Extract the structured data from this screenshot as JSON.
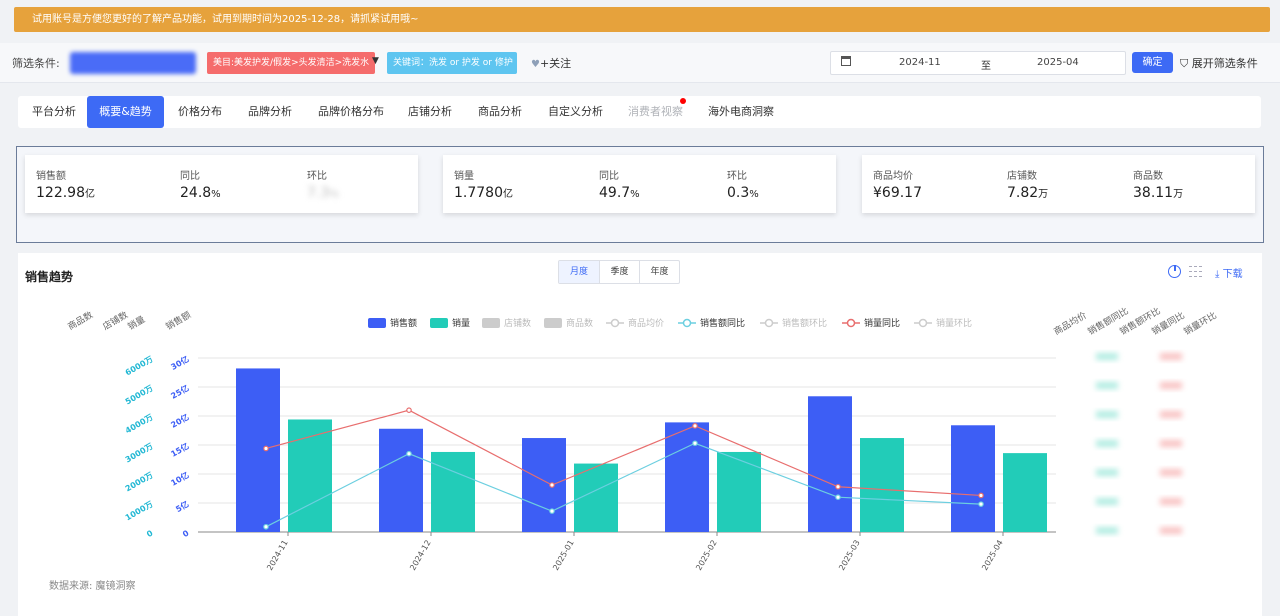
{
  "banner": {
    "text": "试用账号是方便您更好的了解产品功能，试用到期时间为2025-12-28，请抓紧试用哦~"
  },
  "filter": {
    "label": "筛选条件:",
    "category_tag": "美目:美发护发/假发>头发清洁>洗发水",
    "keyword_tag": "关键词：洗发 or 护发 or 修护",
    "follow": "+关注",
    "date_start": "2024-11",
    "date_to": "至",
    "date_end": "2025-04",
    "confirm": "确定",
    "expand": "展开筛选条件"
  },
  "tabs": [
    {
      "label": "平台分析",
      "state": "normal"
    },
    {
      "label": "概要&趋势",
      "state": "active"
    },
    {
      "label": "价格分布",
      "state": "normal"
    },
    {
      "label": "品牌分析",
      "state": "normal"
    },
    {
      "label": "品牌价格分布",
      "state": "normal"
    },
    {
      "label": "店铺分析",
      "state": "normal"
    },
    {
      "label": "商品分析",
      "state": "normal"
    },
    {
      "label": "自定义分析",
      "state": "normal"
    },
    {
      "label": "消费者视察",
      "state": "disabled"
    },
    {
      "label": "海外电商洞察",
      "state": "normal"
    }
  ],
  "kpi_groups": [
    {
      "items": [
        {
          "label": "销售额",
          "value": "122.98",
          "unit": "亿"
        },
        {
          "label": "同比",
          "value": "24.8",
          "unit": "%"
        },
        {
          "label": "环比",
          "value": "7.3",
          "unit": "%",
          "blurred": true
        }
      ]
    },
    {
      "items": [
        {
          "label": "销量",
          "value": "1.7780",
          "unit": "亿"
        },
        {
          "label": "同比",
          "value": "49.7",
          "unit": "%"
        },
        {
          "label": "环比",
          "value": "0.3",
          "unit": "%"
        }
      ]
    },
    {
      "items": [
        {
          "label": "商品均价",
          "value": "¥69.17",
          "unit": ""
        },
        {
          "label": "店铺数",
          "value": "7.82",
          "unit": "万"
        },
        {
          "label": "商品数",
          "value": "38.11",
          "unit": "万"
        }
      ]
    }
  ],
  "trend": {
    "title": "销售趋势",
    "periods": [
      "月度",
      "季度",
      "年度"
    ],
    "active_period": "月度",
    "download": "下载",
    "source": "数据来源: 魔镜洞察",
    "colors": {
      "sales": "#3d5ef5",
      "volume": "#22ccb8",
      "volume_yoy": "#e86e6e",
      "sales_yoy": "#6ccfe0",
      "disabled": "#cccccc"
    }
  },
  "chart_data": {
    "type": "bar",
    "categories": [
      "2024-11",
      "2024-12",
      "2025-01",
      "2025-02",
      "2025-03",
      "2025-04"
    ],
    "left_axes": [
      {
        "name": "商品数",
        "ticks": []
      },
      {
        "name": "店铺数",
        "ticks": []
      },
      {
        "name": "销量",
        "ticks": [
          "0",
          "1000万",
          "2000万",
          "3000万",
          "4000万",
          "5000万",
          "6000万"
        ]
      },
      {
        "name": "销售额",
        "ticks": [
          "0",
          "5亿",
          "10亿",
          "15亿",
          "20亿",
          "25亿",
          "30亿"
        ]
      }
    ],
    "right_axes": [
      {
        "name": "商品均价"
      },
      {
        "name": "销售额同比"
      },
      {
        "name": "销售额环比"
      },
      {
        "name": "销量同比"
      },
      {
        "name": "销量环比"
      }
    ],
    "legend": [
      {
        "name": "销售额",
        "kind": "bar",
        "active": true
      },
      {
        "name": "销量",
        "kind": "bar",
        "active": true
      },
      {
        "name": "店铺数",
        "kind": "bar",
        "active": false
      },
      {
        "name": "商品数",
        "kind": "bar",
        "active": false
      },
      {
        "name": "商品均价",
        "kind": "line",
        "active": false
      },
      {
        "name": "销售额同比",
        "kind": "line",
        "active": true
      },
      {
        "name": "销售额环比",
        "kind": "line",
        "active": false
      },
      {
        "name": "销量同比",
        "kind": "line",
        "active": true
      },
      {
        "name": "销量环比",
        "kind": "line",
        "active": false
      }
    ],
    "series": [
      {
        "name": "销售额",
        "type": "bar",
        "unit": "亿",
        "values": [
          28.2,
          17.8,
          16.2,
          18.9,
          23.4,
          18.4
        ]
      },
      {
        "name": "销量",
        "type": "bar",
        "unit": "万",
        "values": [
          3880,
          2760,
          2360,
          2760,
          3240,
          2720
        ]
      },
      {
        "name": "销量同比",
        "type": "line",
        "values": [
          0.48,
          0.7,
          0.27,
          0.61,
          0.26,
          0.21
        ]
      },
      {
        "name": "销售额同比",
        "type": "line",
        "values": [
          0.03,
          0.45,
          0.12,
          0.51,
          0.2,
          0.16
        ]
      }
    ],
    "ylim_sales": [
      0,
      30
    ],
    "ylim_volume": [
      0,
      6000
    ],
    "grid": true
  }
}
